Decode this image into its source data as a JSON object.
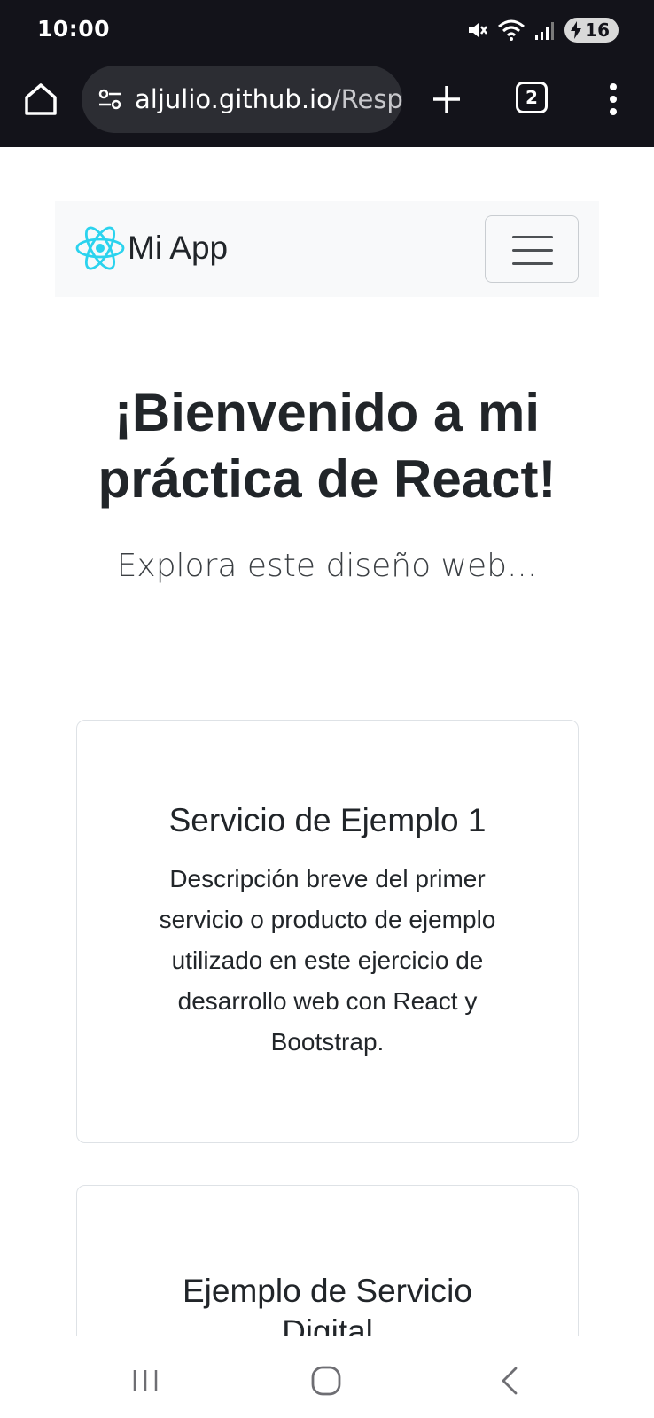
{
  "status_bar": {
    "time": "10:00",
    "battery": "16",
    "icons": [
      "mute-icon",
      "wifi-icon",
      "signal-icon",
      "battery-charging-icon"
    ]
  },
  "browser": {
    "url_host": "aljulio.github.io",
    "url_path": "/Resp",
    "tab_count": "2",
    "icons": [
      "home-icon",
      "site-settings-icon",
      "new-tab-icon",
      "tab-switcher-icon",
      "more-menu-icon"
    ]
  },
  "navbar": {
    "brand": "Mi App",
    "logo": "react-logo",
    "toggler_icon": "hamburger-icon"
  },
  "hero": {
    "title": "¡Bienvenido a mi práctica de React!",
    "subtitle": "Explora este diseño web..."
  },
  "cards": [
    {
      "title": "Servicio de Ejemplo 1",
      "text": "Descripción breve del primer servicio o producto de ejemplo utilizado en este ejercicio de desarrollo web con React y Bootstrap."
    },
    {
      "title": "Ejemplo de Servicio Digital"
    }
  ],
  "colors": {
    "chrome_bg": "#13131a",
    "url_pill_bg": "#2c2d33",
    "navbar_bg": "#f8f9fa",
    "react_logo": "#2bd3ee",
    "text": "#212529"
  },
  "system_nav": {
    "icons": [
      "recents-icon",
      "home-circle-icon",
      "back-icon"
    ]
  }
}
